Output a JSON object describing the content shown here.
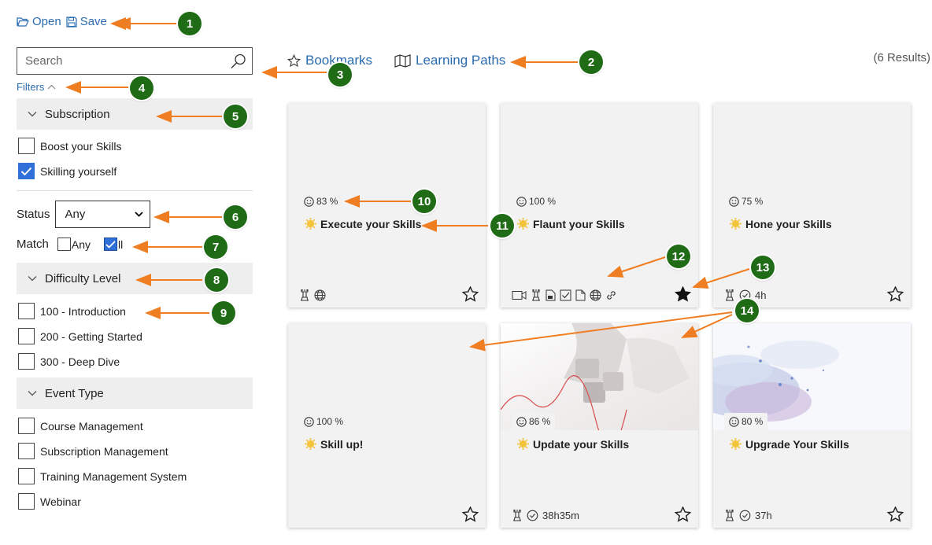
{
  "toolbar": {
    "open_label": "Open",
    "save_label": "Save"
  },
  "search": {
    "placeholder": "Search"
  },
  "filters": {
    "label": "Filters"
  },
  "subscription": {
    "header": "Subscription",
    "options": [
      {
        "label": "Boost your Skills",
        "checked": false
      },
      {
        "label": "Skilling yourself",
        "checked": true
      }
    ]
  },
  "status": {
    "label": "Status",
    "selected": "Any"
  },
  "match": {
    "label": "Match",
    "any_label": "Any",
    "all_label": "ll"
  },
  "difficulty": {
    "header": "Difficulty Level",
    "options": [
      {
        "label": "100 - Introduction"
      },
      {
        "label": "200 - Getting Started"
      },
      {
        "label": "300 - Deep Dive"
      }
    ]
  },
  "event_type": {
    "header": "Event Type",
    "options": [
      {
        "label": "Course Management"
      },
      {
        "label": "Subscription Management"
      },
      {
        "label": "Training Management System"
      },
      {
        "label": "Webinar"
      }
    ]
  },
  "tabs": {
    "bookmarks": "Bookmarks",
    "learning_paths": "Learning Paths"
  },
  "results": "(6 Results)",
  "cards": [
    {
      "percent": "83 %",
      "title": "Execute your Skills",
      "duration": "",
      "bookmarked": false
    },
    {
      "percent": "100 %",
      "title": "Flaunt your Skills",
      "duration": "",
      "bookmarked": true
    },
    {
      "percent": "75 %",
      "title": "Hone your Skills",
      "duration": "4h",
      "bookmarked": false
    },
    {
      "percent": "100 %",
      "title": "Skill up!",
      "duration": "",
      "bookmarked": false
    },
    {
      "percent": "86 %",
      "title": "Update your Skills",
      "duration": "38h35m",
      "bookmarked": false
    },
    {
      "percent": "80 %",
      "title": "Upgrade Your Skills",
      "duration": "37h",
      "bookmarked": false
    }
  ],
  "annotations": [
    "1",
    "2",
    "3",
    "4",
    "5",
    "6",
    "7",
    "8",
    "9",
    "10",
    "11",
    "12",
    "13",
    "14"
  ],
  "colors": {
    "accent": "#2b6cb0",
    "badge": "#1f6b16",
    "arrow": "#ef7d22",
    "card_bg": "#f2f2f2"
  }
}
